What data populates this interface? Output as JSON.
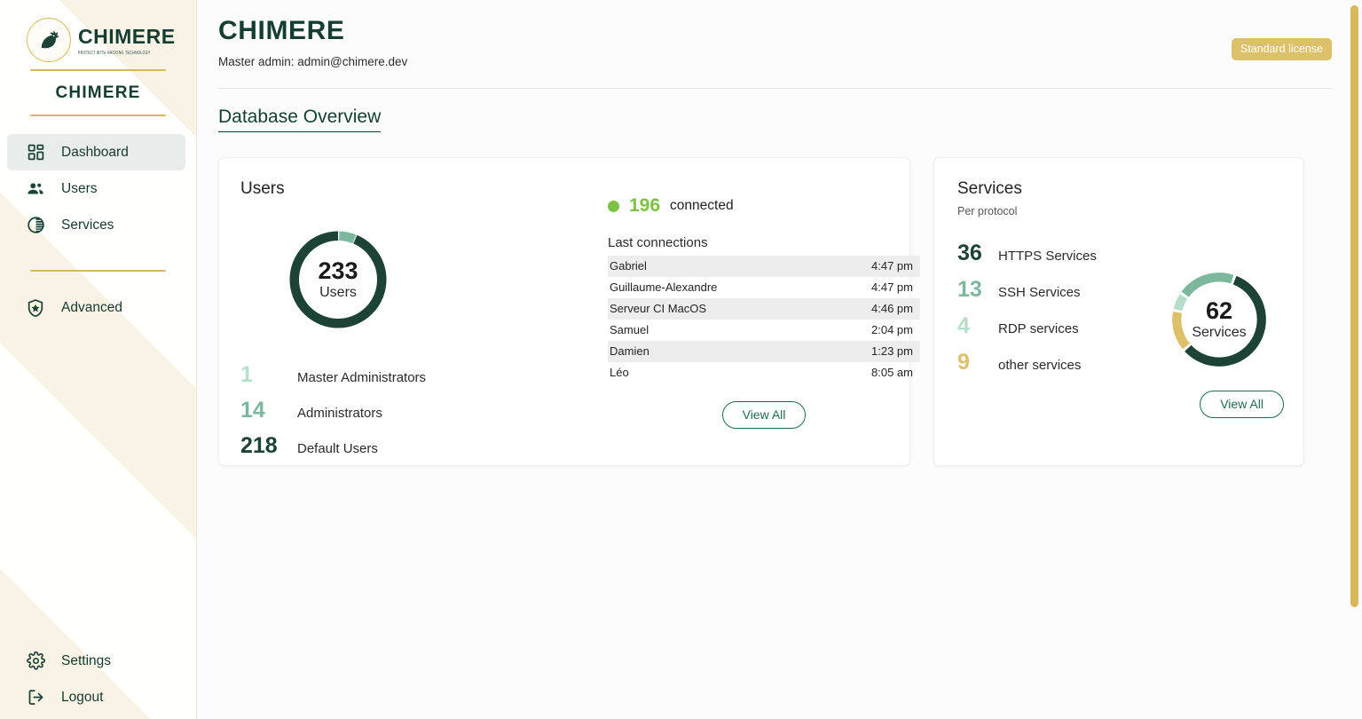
{
  "sidebar": {
    "logo": {
      "word": "CHIMERE",
      "tagline": "PROTECT WITH HACKING TECHNOLOGY",
      "icon": "chimera-griffin-logo"
    },
    "brand_name": "CHIMERE",
    "items": [
      {
        "label": "Dashboard",
        "icon": "dashboard-grid-icon",
        "active": true
      },
      {
        "label": "Users",
        "icon": "users-icon",
        "active": false
      },
      {
        "label": "Services",
        "icon": "contrast-circle-icon",
        "active": false
      },
      {
        "label": "Advanced",
        "icon": "shield-star-icon",
        "active": false
      }
    ],
    "bottom_items": [
      {
        "label": "Settings",
        "icon": "gear-icon"
      },
      {
        "label": "Logout",
        "icon": "logout-arrow-icon"
      }
    ]
  },
  "header": {
    "title": "CHIMERE",
    "subtitle": "Master admin: admin@chimere.dev",
    "license_badge": "Standard license"
  },
  "section": {
    "title": "Database Overview"
  },
  "users_card": {
    "heading": "Users",
    "donut_total": "233",
    "donut_label": "Users",
    "legend": [
      {
        "num": "1",
        "label": "Master Administrators",
        "color": "#b7ddcb"
      },
      {
        "num": "14",
        "label": "Administrators",
        "color": "#7cb79e"
      },
      {
        "num": "218",
        "label": "Default Users",
        "color": "#1d4337"
      }
    ],
    "connected_count": "196",
    "connected_label": "connected",
    "list_title": "Last connections",
    "connections": [
      {
        "name": "Gabriel",
        "time": "4:47 pm"
      },
      {
        "name": "Guillaume-Alexandre",
        "time": "4:47 pm"
      },
      {
        "name": "Serveur CI MacOS",
        "time": "4:46 pm"
      },
      {
        "name": "Samuel",
        "time": "2:04 pm"
      },
      {
        "name": "Damien",
        "time": "1:23 pm"
      },
      {
        "name": "Léo",
        "time": "8:05 am"
      }
    ],
    "view_all": "View All"
  },
  "services_card": {
    "heading": "Services",
    "subheading": "Per protocol",
    "donut_total": "62",
    "donut_label": "Services",
    "legend": [
      {
        "num": "36",
        "label": "HTTPS Services",
        "color": "#1d4337"
      },
      {
        "num": "13",
        "label": "SSH Services",
        "color": "#7cb79e"
      },
      {
        "num": "4",
        "label": "RDP services",
        "color": "#b7ddcb"
      },
      {
        "num": "9",
        "label": "other services",
        "color": "#ddc06a"
      }
    ],
    "view_all": "View All"
  },
  "chart_data": [
    {
      "type": "pie",
      "title": "Users",
      "center_label": "233 Users",
      "categories": [
        "Default Users",
        "Administrators",
        "Master Administrators"
      ],
      "values": [
        218,
        14,
        1
      ],
      "colors": [
        "#1d4337",
        "#7cb79e",
        "#b7ddcb"
      ],
      "total": 233,
      "legend": "right-list"
    },
    {
      "type": "pie",
      "title": "Services",
      "subtitle": "Per protocol",
      "center_label": "62 Services",
      "categories": [
        "HTTPS Services",
        "SSH Services",
        "RDP services",
        "other services"
      ],
      "values": [
        36,
        13,
        4,
        9
      ],
      "colors": [
        "#1d4337",
        "#7cb79e",
        "#b7ddcb",
        "#ddc06a"
      ],
      "total": 62,
      "legend": "left-list"
    }
  ],
  "colors": {
    "brand_dark": "#153d32",
    "gold": "#d9b85c",
    "accent_green": "#7dc242",
    "mid_green": "#7cb79e",
    "light_green": "#b7ddcb"
  }
}
